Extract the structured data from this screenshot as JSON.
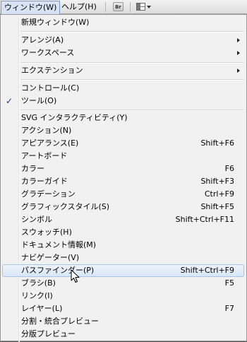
{
  "menubar": {
    "window_label": "ウィンドウ(W)",
    "help_label": "ヘルプ(H)",
    "bridge_label": "Br"
  },
  "menu": {
    "items": [
      {
        "label": "新規ウィンドウ(W)",
        "shortcut": ""
      },
      {
        "label": "アレンジ(A)",
        "shortcut": ""
      },
      {
        "label": "ワークスペース",
        "shortcut": ""
      },
      {
        "label": "エクステンション",
        "shortcut": ""
      },
      {
        "label": "コントロール(C)",
        "shortcut": ""
      },
      {
        "label": "ツール(O)",
        "shortcut": "",
        "checkmark": "✓"
      },
      {
        "label": "SVG インタラクティビティ(Y)",
        "shortcut": ""
      },
      {
        "label": "アクション(N)",
        "shortcut": ""
      },
      {
        "label": "アピアランス(E)",
        "shortcut": "Shift+F6"
      },
      {
        "label": "アートボード",
        "shortcut": ""
      },
      {
        "label": "カラー",
        "shortcut": "F6"
      },
      {
        "label": "カラーガイド",
        "shortcut": "Shift+F3"
      },
      {
        "label": "グラデーション",
        "shortcut": "Ctrl+F9"
      },
      {
        "label": "グラフィックスタイル(S)",
        "shortcut": "Shift+F5"
      },
      {
        "label": "シンボル",
        "shortcut": "Shift+Ctrl+F11"
      },
      {
        "label": "スウォッチ(H)",
        "shortcut": ""
      },
      {
        "label": "ドキュメント情報(M)",
        "shortcut": ""
      },
      {
        "label": "ナビゲーター(V)",
        "shortcut": ""
      },
      {
        "label": "パスファインダー(P)",
        "shortcut": "Shift+Ctrl+F9"
      },
      {
        "label": "ブラシ(B)",
        "shortcut": "F5"
      },
      {
        "label": "リンク(I)",
        "shortcut": ""
      },
      {
        "label": "レイヤー(L)",
        "shortcut": "F7"
      },
      {
        "label": "分割・統合プレビュー",
        "shortcut": ""
      },
      {
        "label": "分版プレビュー",
        "shortcut": ""
      }
    ]
  }
}
